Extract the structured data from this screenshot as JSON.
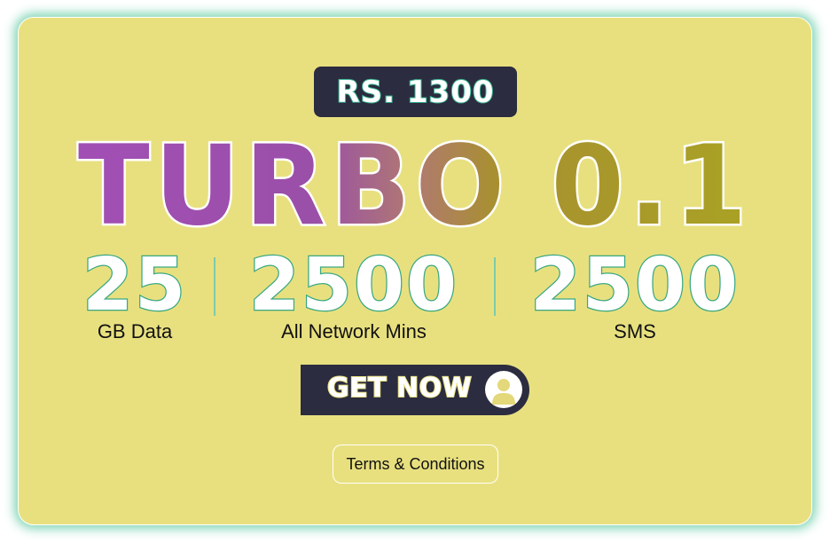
{
  "offer": {
    "price": "RS. 1300",
    "package_name": "TURBO 0.1",
    "stats": [
      {
        "value": "25",
        "label": "GB Data"
      },
      {
        "value": "2500",
        "label": "All Network Mins"
      },
      {
        "value": "2500",
        "label": "SMS"
      }
    ]
  },
  "actions": {
    "cta_label": "GET NOW",
    "cta_icon": "user-avatar-icon",
    "terms_label": "Terms & Conditions"
  },
  "colors": {
    "card_background": "#e8e07f",
    "dark_badge": "#2b2c40",
    "accent_teal": "#35b08c",
    "glitter_purple": "#a24fb5",
    "glitter_gold": "#a9a224"
  }
}
